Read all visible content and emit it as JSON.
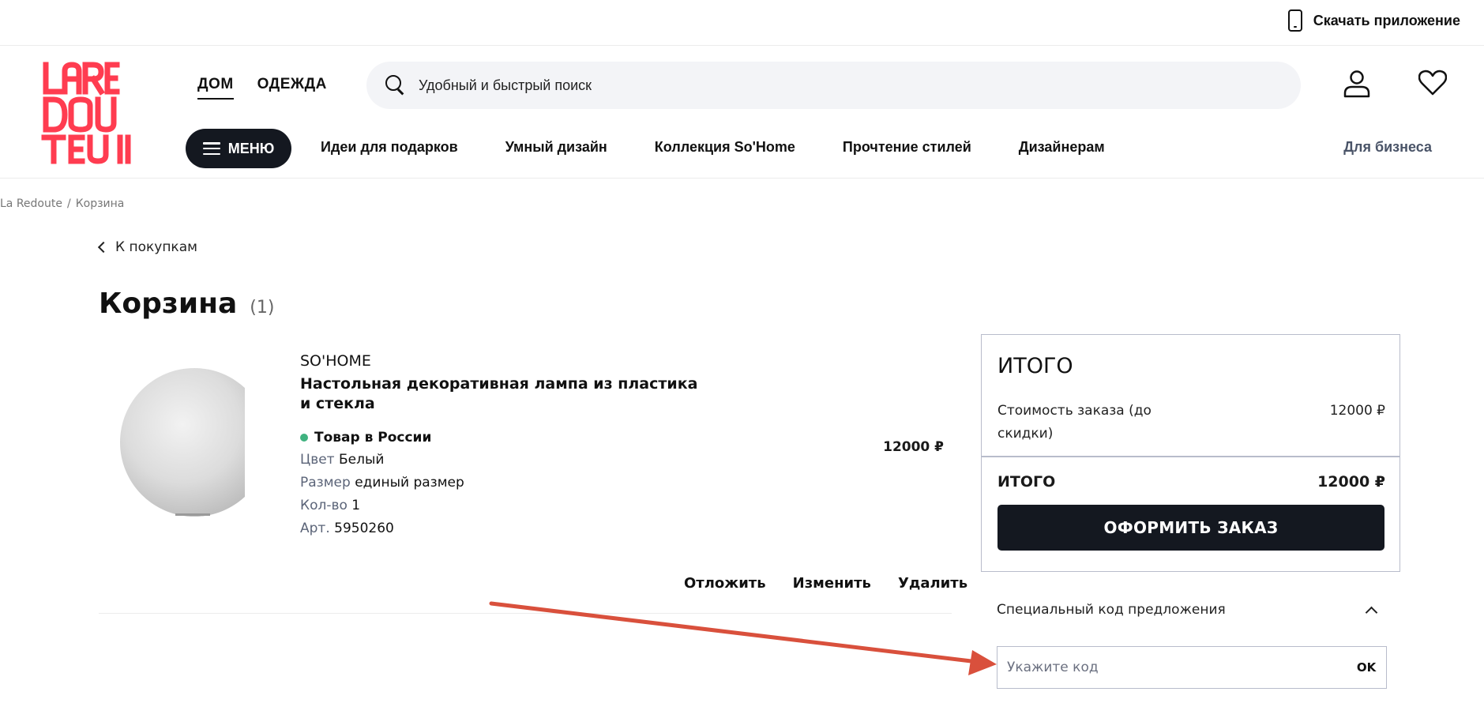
{
  "topbar": {
    "app_label": "Скачать приложение"
  },
  "header": {
    "logo_alt": "La Redoute",
    "logo_letters": [
      "LARE",
      "DOU",
      "TE"
    ],
    "tabs": [
      {
        "label": "ДОМ",
        "active": true
      },
      {
        "label": "ОДЕЖДА",
        "active": false
      }
    ],
    "search": {
      "placeholder": "Удобный и быстрый поиск"
    },
    "menu_label": "МЕНЮ",
    "categories": [
      "Идеи для подарков",
      "Умный дизайн",
      "Коллекция So'Home",
      "Прочтение стилей",
      "Дизайнерам"
    ],
    "business_label": "Для бизнеса"
  },
  "breadcrumb": {
    "root": "La Redoute",
    "sep": "/",
    "current": "Корзина"
  },
  "back_label": "К покупкам",
  "page": {
    "title": "Корзина",
    "count": "(1)"
  },
  "product": {
    "brand": "SO'HOME",
    "name": "Настольная декоративная лампа из пластика и стекла",
    "stock": "Товар в России",
    "color_label": "Цвет",
    "color_value": "Белый",
    "size_label": "Размер",
    "size_value": "единый размер",
    "qty_label": "Кол-во",
    "qty_value": "1",
    "sku_label": "Арт.",
    "sku_value": "5950260",
    "price": "12000 ₽",
    "actions": {
      "postpone": "Отложить",
      "edit": "Изменить",
      "delete": "Удалить"
    }
  },
  "summary": {
    "title": "ИТОГО",
    "subtotal_label": "Стоимость заказа (до скидки)",
    "subtotal_value": "12000 ₽",
    "total_label": "ИТОГО",
    "total_value": "12000 ₽",
    "checkout_label": "ОФОРМИТЬ ЗАКАЗ"
  },
  "promo": {
    "toggle_label": "Специальный код предложения",
    "placeholder": "Укажите код",
    "submit_label": "OK"
  },
  "colors": {
    "brand_red": "#ff3c50",
    "dark": "#141820",
    "stock_green": "#3fb27f",
    "annotation_arrow": "#d9503c"
  }
}
